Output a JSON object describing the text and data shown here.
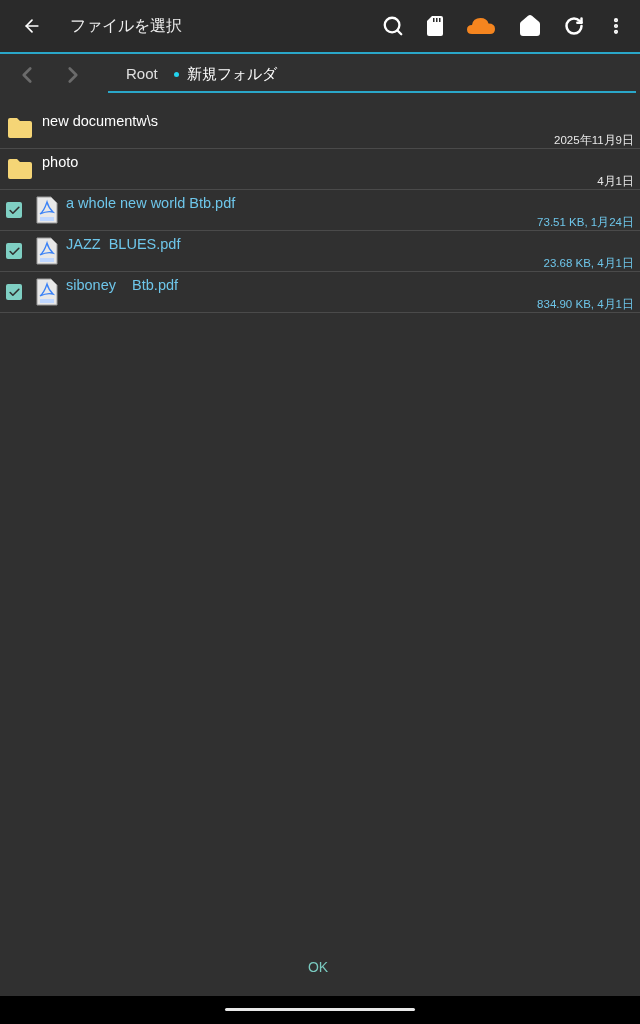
{
  "app_bar": {
    "title": "ファイルを選択"
  },
  "breadcrumb": [
    {
      "label": "Root",
      "selected": false
    },
    {
      "label": "新規フォルダ",
      "selected": true
    }
  ],
  "items": [
    {
      "kind": "folder",
      "name": "new documentw\\s",
      "details": "2025年11月9日"
    },
    {
      "kind": "folder",
      "name": "photo",
      "details": "4月1日"
    },
    {
      "kind": "file",
      "name": "a whole new world Btb.pdf",
      "details": "73.51 KB, 1月24日",
      "checked": true
    },
    {
      "kind": "file",
      "name": "JAZZ  BLUES.pdf",
      "details": "23.68 KB, 4月1日",
      "checked": true
    },
    {
      "kind": "file",
      "name": "siboney    Btb.pdf",
      "details": "834.90 KB, 4月1日",
      "checked": true
    }
  ],
  "ok_button": "OK"
}
